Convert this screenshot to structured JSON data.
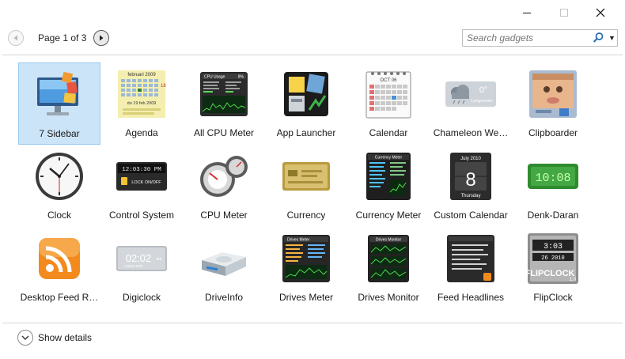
{
  "window": {
    "minimize_icon": "minimize-icon",
    "maximize_icon": "maximize-icon",
    "close_icon": "close-icon"
  },
  "pager": {
    "label": "Page 1 of 3"
  },
  "search": {
    "placeholder": "Search gadgets",
    "value": ""
  },
  "gadgets": [
    {
      "label": "7 Sidebar",
      "icon": "monitor-sidebar-icon",
      "selected": true
    },
    {
      "label": "Agenda",
      "icon": "agenda-calendar-icon"
    },
    {
      "label": "All CPU Meter",
      "icon": "cpu-usage-meter-icon"
    },
    {
      "label": "App Launcher",
      "icon": "app-launcher-icon"
    },
    {
      "label": "Calendar",
      "icon": "spiral-calendar-icon"
    },
    {
      "label": "Chameleon We…",
      "icon": "weather-cloud-icon"
    },
    {
      "label": "Clipboarder",
      "icon": "clipboard-photo-icon"
    },
    {
      "label": "Clock",
      "icon": "analog-clock-icon"
    },
    {
      "label": "Control System",
      "icon": "control-system-icon"
    },
    {
      "label": "CPU Meter",
      "icon": "cpu-gauge-icon"
    },
    {
      "label": "Currency",
      "icon": "currency-card-icon"
    },
    {
      "label": "Currency Meter",
      "icon": "currency-meter-icon"
    },
    {
      "label": "Custom Calendar",
      "icon": "custom-calendar-icon"
    },
    {
      "label": "Denk-Daran",
      "icon": "green-digital-icon"
    },
    {
      "label": "Desktop Feed R…",
      "icon": "rss-feed-icon"
    },
    {
      "label": "Digiclock",
      "icon": "digital-clock-icon"
    },
    {
      "label": "DriveInfo",
      "icon": "hard-drive-icon"
    },
    {
      "label": "Drives Meter",
      "icon": "drives-meter-icon"
    },
    {
      "label": "Drives Monitor",
      "icon": "drives-monitor-icon"
    },
    {
      "label": "Feed Headlines",
      "icon": "feed-headlines-icon"
    },
    {
      "label": "FlipClock",
      "icon": "flip-clock-icon"
    }
  ],
  "thumb_text": {
    "agenda_month": "februari 2009",
    "agenda_day": "18",
    "agenda_footer": "do 19 feb 2009",
    "cpu_title": "CPU Usage",
    "cpu_pct": "8%",
    "calendar_month": "OCT 06",
    "weather_temp": "0°",
    "weather_place": "Langemark",
    "control_time": "12:03:30 PM",
    "control_lock": "LOCK ON/OFF",
    "currency_meter_title": "Currency Meter",
    "custom_cal_month": "July 2010",
    "custom_cal_day": "8",
    "custom_cal_weekday": "Thursday",
    "denk_time": "10:08",
    "digiclock_time": "02:02",
    "digiclock_ampm": "am",
    "digiclock_sub": "Adobe-CDT",
    "drives_meter_title": "Drives Meter",
    "drives_monitor_title": "Drives Monitor",
    "flip_top": "3:03",
    "flip_date": "26 2010",
    "flip_brand": "FLIPCLOCK",
    "flip_version": "1.0"
  },
  "footer": {
    "details_label": "Show details"
  }
}
